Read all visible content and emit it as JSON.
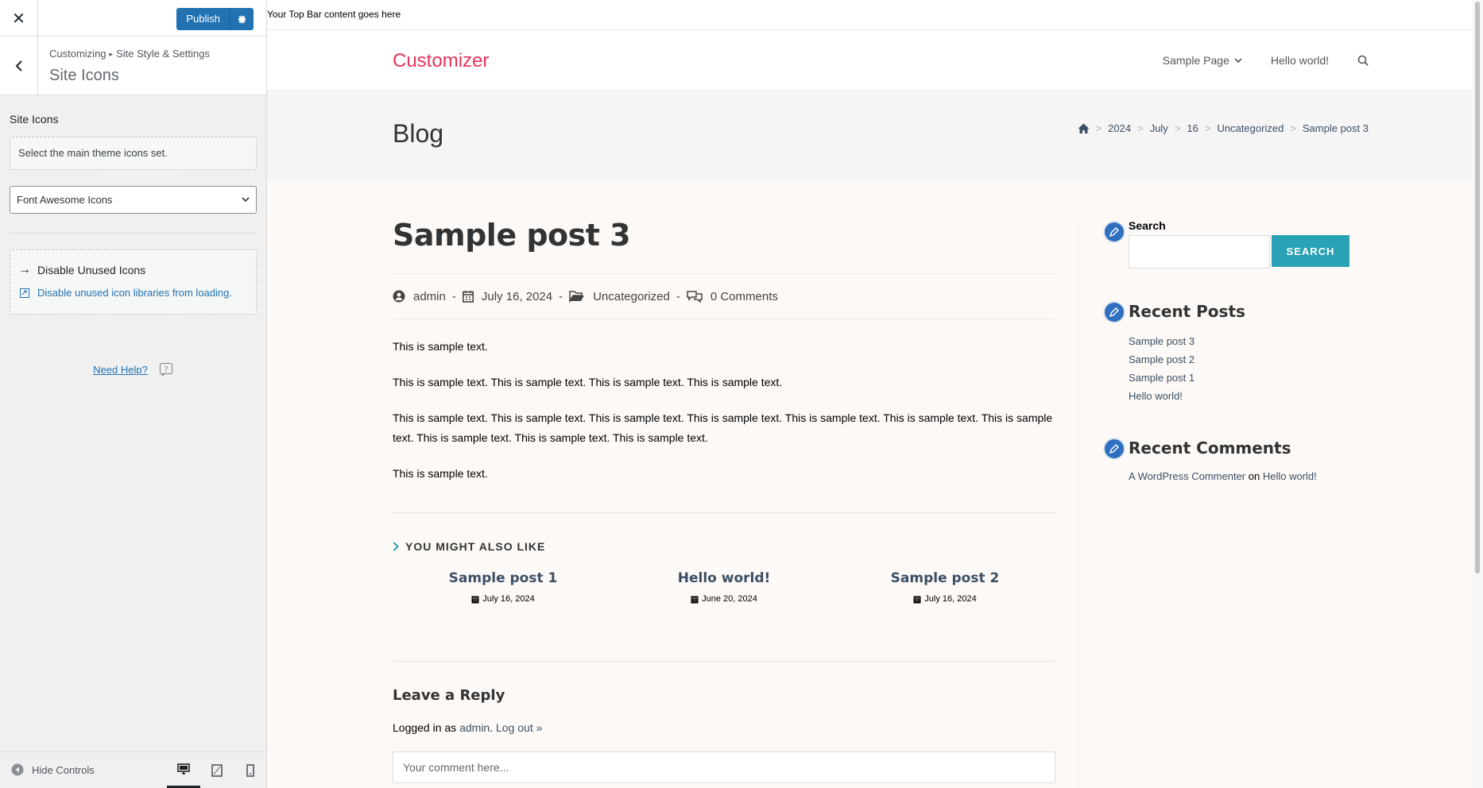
{
  "customizer": {
    "publish_label": "Publish",
    "breadcrumb": [
      "Customizing",
      "Site Style & Settings"
    ],
    "section_title": "Site Icons",
    "control_title": "Site Icons",
    "control_description": "Select the main theme icons set.",
    "icons_select": {
      "selected": "Font Awesome Icons"
    },
    "unused": {
      "title": "Disable Unused Icons",
      "link": "Disable unused icon libraries from loading."
    },
    "help_label": "Need Help?",
    "hide_controls_label": "Hide Controls",
    "accent_color": "#2271b1"
  },
  "preview": {
    "topbar_text": "Your Top Bar content goes here",
    "site_title": "Customizer",
    "nav": [
      "Sample Page",
      "Hello world!"
    ],
    "page_title": "Blog",
    "breadcrumbs": [
      "2024",
      "July",
      "16",
      "Uncategorized",
      "Sample post 3"
    ],
    "post": {
      "title": "Sample post 3",
      "author": "admin",
      "date": "July 16, 2024",
      "category": "Uncategorized",
      "comments": "0 Comments",
      "paragraphs": [
        "This is sample text.",
        "This is sample text. This is sample text. This is sample text. This is sample text.",
        "This is sample text. This is sample text. This is sample text. This is sample text. This is sample text. This is sample text. This is sample text. This is sample text. This is sample text. This is sample text.",
        "This is sample text."
      ]
    },
    "related": {
      "title": "YOU MIGHT ALSO LIKE",
      "items": [
        {
          "title": "Sample post 1",
          "date": "July 16, 2024"
        },
        {
          "title": "Hello world!",
          "date": "June 20, 2024"
        },
        {
          "title": "Sample post 2",
          "date": "July 16, 2024"
        }
      ]
    },
    "reply": {
      "title": "Leave a Reply",
      "logged_in_prefix": "Logged in as",
      "user": "admin",
      "logout": "Log out »",
      "placeholder": "Your comment here..."
    },
    "widgets": {
      "search_title": "Search",
      "search_button": "SEARCH",
      "recent_posts_title": "Recent Posts",
      "recent_posts": [
        "Sample post 3",
        "Sample post 2",
        "Sample post 1",
        "Hello world!"
      ],
      "recent_comments_title": "Recent Comments",
      "comment_author": "A WordPress Commenter",
      "comment_on": "on",
      "comment_post": "Hello world!"
    },
    "colors": {
      "site_title": "#e8325b",
      "search_button": "#2aa2b5",
      "widget_icon": "#2e6fbf"
    }
  }
}
